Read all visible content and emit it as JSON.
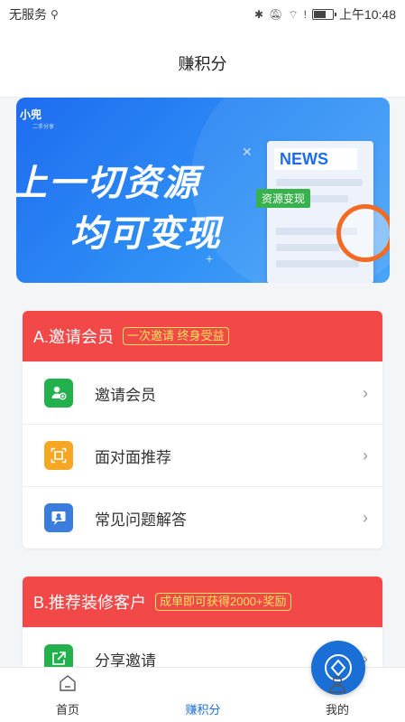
{
  "status_bar": {
    "carrier": "无服务",
    "usb_icon": "usb-icon",
    "time": "上午10:48",
    "battery_level": 0.7,
    "icons": [
      "bluetooth-icon",
      "mute-icon",
      "wifi-icon",
      "alert-icon",
      "battery-icon"
    ]
  },
  "header": {
    "title": "赚积分"
  },
  "banner": {
    "line1": "上一切资源",
    "line2": "均可变现",
    "news_label": "NEWS",
    "tag": "资源变现",
    "brand": "小兜",
    "brand_sub": "二手分享"
  },
  "section_a": {
    "title": "A.邀请会员",
    "badge": "一次邀请 终身受益",
    "items": [
      {
        "label": "邀请会员",
        "icon": "add-user-icon",
        "color": "#22b14c"
      },
      {
        "label": "面对面推荐",
        "icon": "scan-icon",
        "color": "#f5a623"
      },
      {
        "label": "常见问题解答",
        "icon": "faq-icon",
        "color": "#3b7ddd"
      }
    ]
  },
  "section_b": {
    "title": "B.推荐装修客户",
    "badge": "成单即可获得2000+奖励",
    "items": [
      {
        "label": "分享邀请",
        "icon": "share-icon",
        "color": "#22b14c"
      }
    ]
  },
  "bottom_nav": {
    "items": [
      {
        "label": "首页",
        "icon": "home-icon"
      },
      {
        "label": "赚积分",
        "icon": "points-icon",
        "active": true
      },
      {
        "label": "我的",
        "icon": "profile-icon"
      }
    ]
  },
  "colors": {
    "accent_red": "#f24848",
    "badge_yellow": "#ffe45c",
    "active_blue": "#1a6fd6"
  }
}
